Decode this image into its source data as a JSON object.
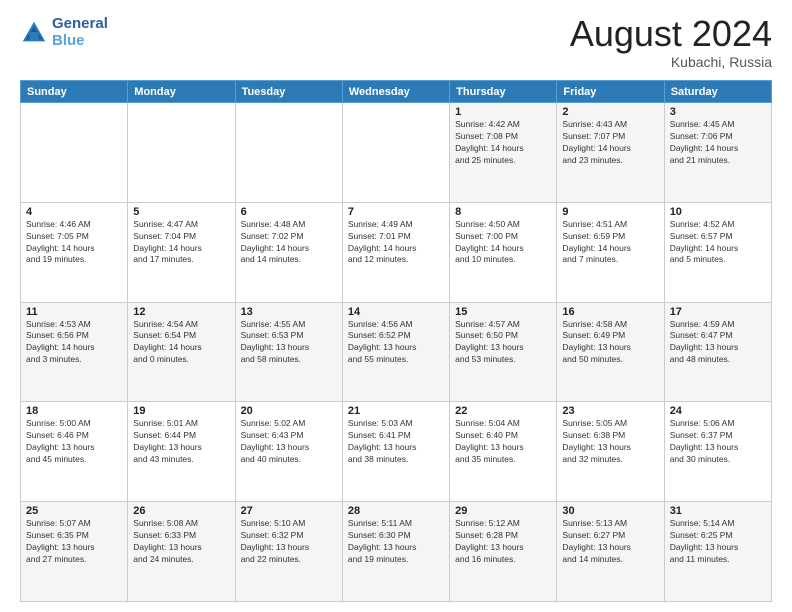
{
  "logo": {
    "text_general": "General",
    "text_blue": "Blue"
  },
  "title": "August 2024",
  "location": "Kubachi, Russia",
  "days_of_week": [
    "Sunday",
    "Monday",
    "Tuesday",
    "Wednesday",
    "Thursday",
    "Friday",
    "Saturday"
  ],
  "weeks": [
    [
      {
        "day": "",
        "info": ""
      },
      {
        "day": "",
        "info": ""
      },
      {
        "day": "",
        "info": ""
      },
      {
        "day": "",
        "info": ""
      },
      {
        "day": "1",
        "info": "Sunrise: 4:42 AM\nSunset: 7:08 PM\nDaylight: 14 hours\nand 25 minutes."
      },
      {
        "day": "2",
        "info": "Sunrise: 4:43 AM\nSunset: 7:07 PM\nDaylight: 14 hours\nand 23 minutes."
      },
      {
        "day": "3",
        "info": "Sunrise: 4:45 AM\nSunset: 7:06 PM\nDaylight: 14 hours\nand 21 minutes."
      }
    ],
    [
      {
        "day": "4",
        "info": "Sunrise: 4:46 AM\nSunset: 7:05 PM\nDaylight: 14 hours\nand 19 minutes."
      },
      {
        "day": "5",
        "info": "Sunrise: 4:47 AM\nSunset: 7:04 PM\nDaylight: 14 hours\nand 17 minutes."
      },
      {
        "day": "6",
        "info": "Sunrise: 4:48 AM\nSunset: 7:02 PM\nDaylight: 14 hours\nand 14 minutes."
      },
      {
        "day": "7",
        "info": "Sunrise: 4:49 AM\nSunset: 7:01 PM\nDaylight: 14 hours\nand 12 minutes."
      },
      {
        "day": "8",
        "info": "Sunrise: 4:50 AM\nSunset: 7:00 PM\nDaylight: 14 hours\nand 10 minutes."
      },
      {
        "day": "9",
        "info": "Sunrise: 4:51 AM\nSunset: 6:59 PM\nDaylight: 14 hours\nand 7 minutes."
      },
      {
        "day": "10",
        "info": "Sunrise: 4:52 AM\nSunset: 6:57 PM\nDaylight: 14 hours\nand 5 minutes."
      }
    ],
    [
      {
        "day": "11",
        "info": "Sunrise: 4:53 AM\nSunset: 6:56 PM\nDaylight: 14 hours\nand 3 minutes."
      },
      {
        "day": "12",
        "info": "Sunrise: 4:54 AM\nSunset: 6:54 PM\nDaylight: 14 hours\nand 0 minutes."
      },
      {
        "day": "13",
        "info": "Sunrise: 4:55 AM\nSunset: 6:53 PM\nDaylight: 13 hours\nand 58 minutes."
      },
      {
        "day": "14",
        "info": "Sunrise: 4:56 AM\nSunset: 6:52 PM\nDaylight: 13 hours\nand 55 minutes."
      },
      {
        "day": "15",
        "info": "Sunrise: 4:57 AM\nSunset: 6:50 PM\nDaylight: 13 hours\nand 53 minutes."
      },
      {
        "day": "16",
        "info": "Sunrise: 4:58 AM\nSunset: 6:49 PM\nDaylight: 13 hours\nand 50 minutes."
      },
      {
        "day": "17",
        "info": "Sunrise: 4:59 AM\nSunset: 6:47 PM\nDaylight: 13 hours\nand 48 minutes."
      }
    ],
    [
      {
        "day": "18",
        "info": "Sunrise: 5:00 AM\nSunset: 6:46 PM\nDaylight: 13 hours\nand 45 minutes."
      },
      {
        "day": "19",
        "info": "Sunrise: 5:01 AM\nSunset: 6:44 PM\nDaylight: 13 hours\nand 43 minutes."
      },
      {
        "day": "20",
        "info": "Sunrise: 5:02 AM\nSunset: 6:43 PM\nDaylight: 13 hours\nand 40 minutes."
      },
      {
        "day": "21",
        "info": "Sunrise: 5:03 AM\nSunset: 6:41 PM\nDaylight: 13 hours\nand 38 minutes."
      },
      {
        "day": "22",
        "info": "Sunrise: 5:04 AM\nSunset: 6:40 PM\nDaylight: 13 hours\nand 35 minutes."
      },
      {
        "day": "23",
        "info": "Sunrise: 5:05 AM\nSunset: 6:38 PM\nDaylight: 13 hours\nand 32 minutes."
      },
      {
        "day": "24",
        "info": "Sunrise: 5:06 AM\nSunset: 6:37 PM\nDaylight: 13 hours\nand 30 minutes."
      }
    ],
    [
      {
        "day": "25",
        "info": "Sunrise: 5:07 AM\nSunset: 6:35 PM\nDaylight: 13 hours\nand 27 minutes."
      },
      {
        "day": "26",
        "info": "Sunrise: 5:08 AM\nSunset: 6:33 PM\nDaylight: 13 hours\nand 24 minutes."
      },
      {
        "day": "27",
        "info": "Sunrise: 5:10 AM\nSunset: 6:32 PM\nDaylight: 13 hours\nand 22 minutes."
      },
      {
        "day": "28",
        "info": "Sunrise: 5:11 AM\nSunset: 6:30 PM\nDaylight: 13 hours\nand 19 minutes."
      },
      {
        "day": "29",
        "info": "Sunrise: 5:12 AM\nSunset: 6:28 PM\nDaylight: 13 hours\nand 16 minutes."
      },
      {
        "day": "30",
        "info": "Sunrise: 5:13 AM\nSunset: 6:27 PM\nDaylight: 13 hours\nand 14 minutes."
      },
      {
        "day": "31",
        "info": "Sunrise: 5:14 AM\nSunset: 6:25 PM\nDaylight: 13 hours\nand 11 minutes."
      }
    ]
  ]
}
